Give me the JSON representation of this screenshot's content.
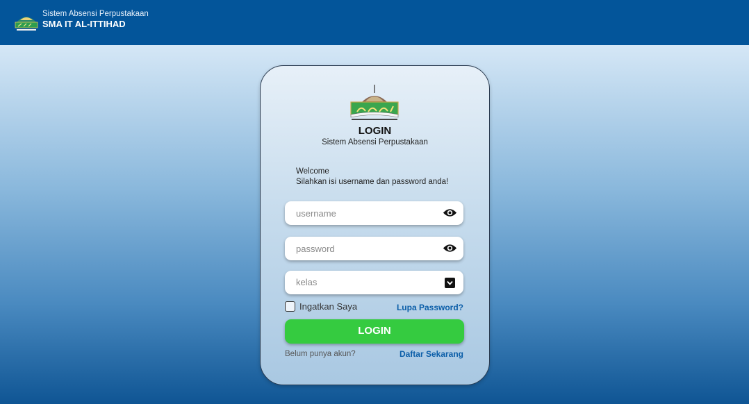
{
  "header": {
    "subtitle": "Sistem Absensi Perpustakaan",
    "title": "SMA IT AL-ITTIHAD",
    "logo_icon": "school-logo"
  },
  "login_card": {
    "title": "LOGIN",
    "subtitle": "Sistem Absensi Perpustakaan",
    "welcome": "Welcome",
    "instruction": "Silahkan isi username dan password anda!",
    "username": {
      "placeholder": "username",
      "value": "",
      "icon": "eye-icon"
    },
    "password": {
      "placeholder": "password",
      "value": "",
      "icon": "eye-icon"
    },
    "kelas": {
      "selected": "kelas",
      "icon": "chevron-down-icon"
    },
    "remember_label": "Ingatkan Saya",
    "remember_checked": false,
    "forgot_label": "Lupa Password?",
    "login_button": "LOGIN",
    "no_account": "Belum punya akun?",
    "register_link": "Daftar Sekarang"
  },
  "colors": {
    "header_bg": "#03559a",
    "accent_green": "#35cb40",
    "link_blue": "#0b5ea8"
  }
}
